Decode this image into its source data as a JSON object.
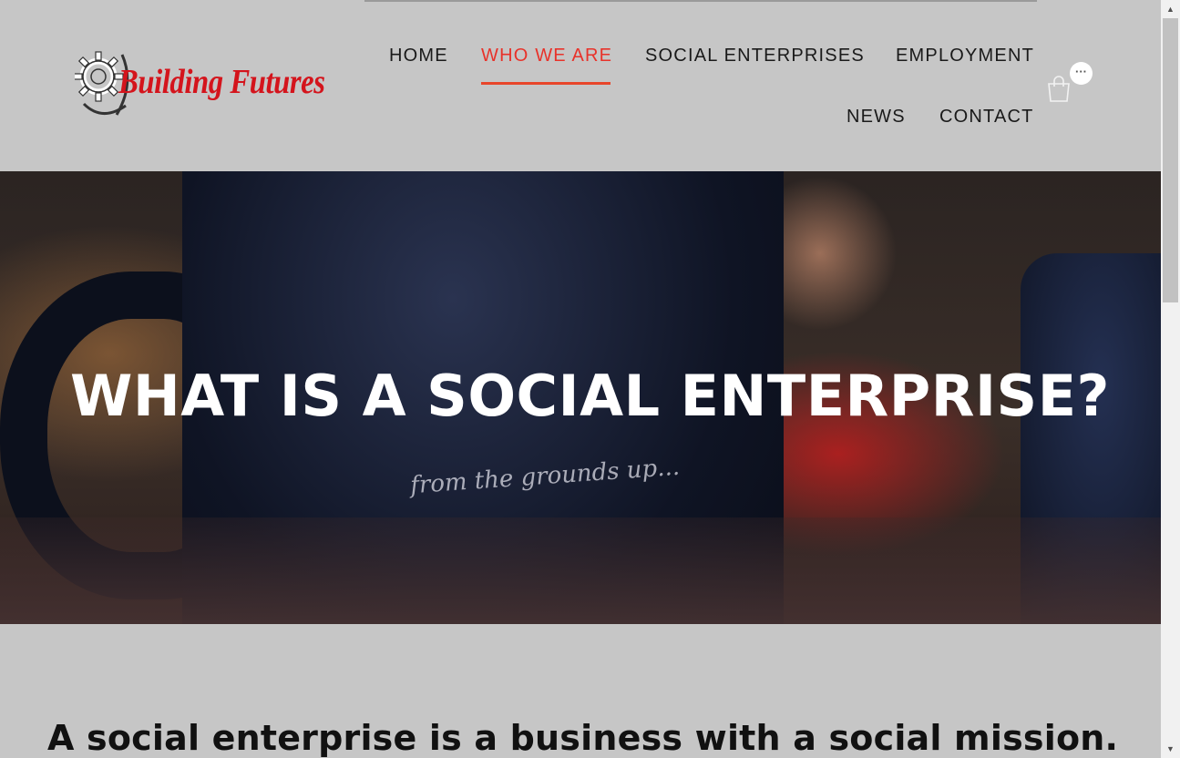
{
  "logo": {
    "text": "Building Futures",
    "icon": "gear-icon"
  },
  "nav": {
    "items": [
      {
        "label": "HOME",
        "active": false
      },
      {
        "label": "WHO WE ARE",
        "active": true
      },
      {
        "label": "SOCIAL ENTERPRISES",
        "active": false
      },
      {
        "label": "EMPLOYMENT",
        "active": false
      },
      {
        "label": "NEWS",
        "active": false
      },
      {
        "label": "CONTACT",
        "active": false
      }
    ],
    "cart_icon": "shopping-bag-icon",
    "more_label": "···"
  },
  "hero": {
    "title": "WHAT IS A SOCIAL ENTERPRISE?",
    "image_text": "from the grounds up..."
  },
  "content": {
    "subheading": "A social enterprise is a business with a social mission."
  },
  "scrollbar": {
    "up": "▲",
    "down": "▼"
  },
  "colors": {
    "accent": "#e8322a",
    "brand_red": "#d4141c",
    "header_bg": "#c6c6c6"
  }
}
